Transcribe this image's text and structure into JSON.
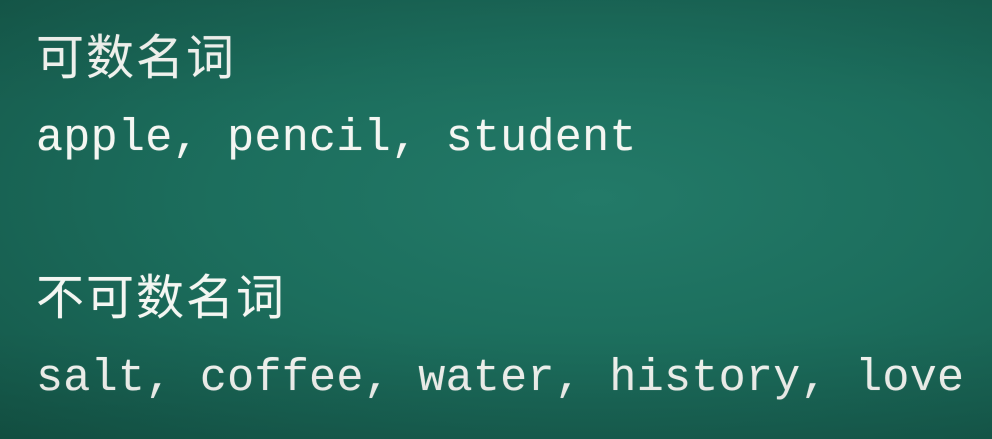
{
  "board": {
    "background_color": "#1c6e5d",
    "text_color": "#f4f6f2"
  },
  "countable": {
    "heading": "可数名词",
    "examples": "apple, pencil, student"
  },
  "uncountable": {
    "heading": "不可数名词",
    "examples": "salt, coffee, water, history, love"
  }
}
